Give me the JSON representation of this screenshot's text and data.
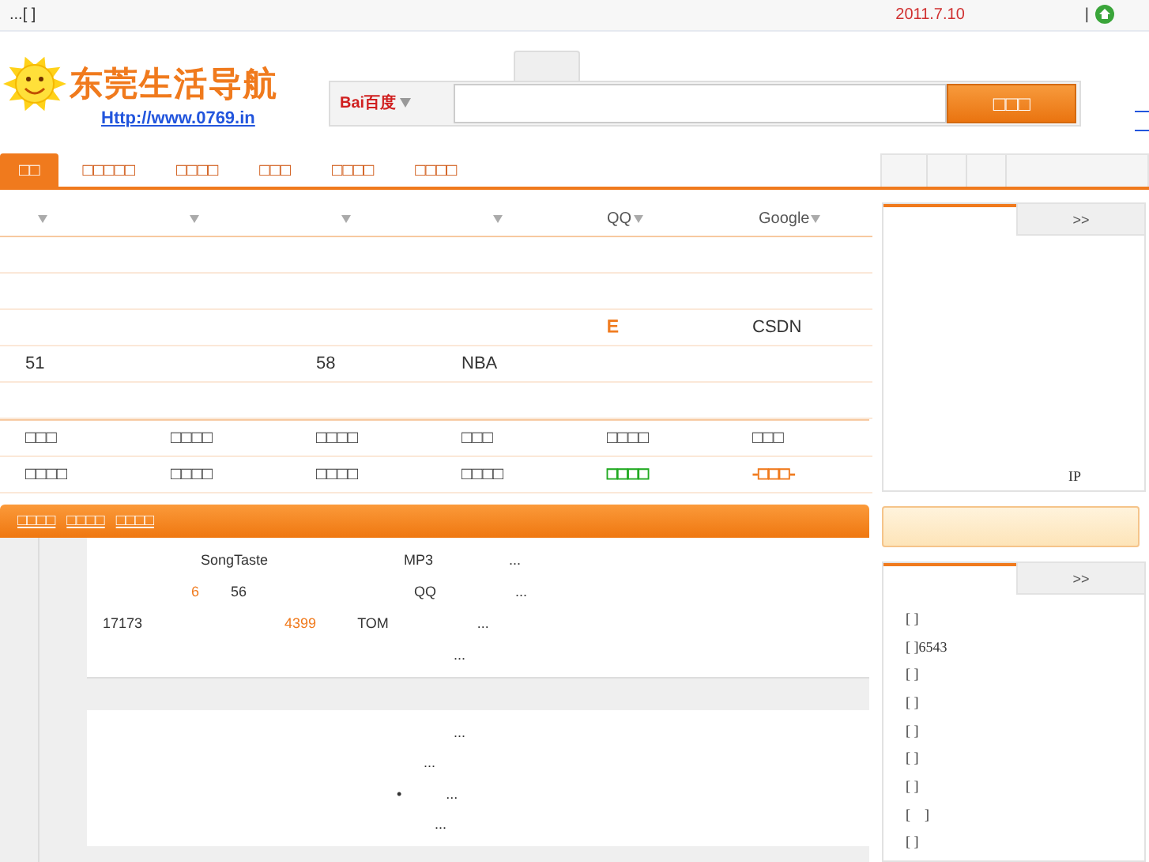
{
  "top_bar": {
    "left_text": "...[ ]",
    "date": "2011.7.10",
    "separator": "|"
  },
  "header": {
    "logo_text": "东莞生活导航",
    "site_link": "Http://www.0769.in",
    "search": {
      "engine": "Bai百度",
      "button": "□□□"
    }
  },
  "nav": {
    "tabs": [
      {
        "label": "□□",
        "selected": true
      },
      {
        "label": "□□□□□",
        "selected": false
      },
      {
        "label": "□□□□",
        "selected": false
      },
      {
        "label": "□□□",
        "selected": false
      },
      {
        "label": "□□□□",
        "selected": false
      },
      {
        "label": "□□□□",
        "selected": false
      }
    ]
  },
  "table": {
    "columns": [
      {
        "sortable": true
      },
      {
        "sortable": true
      },
      {
        "sortable": true
      },
      {
        "sortable": true
      },
      {
        "label": "QQ",
        "sortable": true
      },
      {
        "label": "Google",
        "sortable": true
      }
    ],
    "rows": [
      {},
      {},
      {
        "column_5": {
          "text": "E",
          "color": "#f07a1d"
        },
        "column_6": {
          "text": "CSDN"
        }
      },
      {
        "column_1": {
          "text": "51"
        },
        "column_3": {
          "text": "58"
        },
        "column_4": {
          "text": "NBA"
        }
      },
      {}
    ]
  },
  "quick_links": {
    "rows": [
      {
        "column_1": {
          "text": "□□□"
        },
        "column_2": {
          "text": "□□□□"
        },
        "column_3": {
          "text": "□□□□"
        },
        "column_4": {
          "text": "□□□"
        },
        "column_5": {
          "text": "□□□□"
        },
        "column_6": {
          "text": "□□□"
        }
      },
      {
        "column_1": {
          "text": "□□□□"
        },
        "column_2": {
          "text": "□□□□"
        },
        "column_3": {
          "text": "□□□□"
        },
        "column_4": {
          "text": "□□□□"
        },
        "column_5": {
          "text": "□□□□",
          "color": "#22aa22"
        },
        "column_6": {
          "text": "-□□□-",
          "color": "#f07a1d"
        }
      }
    ]
  },
  "content_panel": {
    "tabs": [
      "□□□□",
      "□□□□",
      "□□□□"
    ],
    "blocks": [
      [
        [
          {
            "text": "SongTaste"
          },
          {
            "text": "MP3"
          },
          {
            "text": "..."
          }
        ],
        [
          {
            "text": "6",
            "color": "#f07a1d"
          },
          {
            "text": "56"
          },
          {
            "text": "QQ"
          },
          {
            "text": "..."
          }
        ],
        [
          {
            "text": "17173"
          },
          {
            "text": "4399",
            "color": "#f07a1d"
          },
          {
            "text": "TOM"
          },
          {
            "text": "..."
          }
        ],
        [
          {
            "text": "..."
          }
        ]
      ],
      [
        [
          {
            "text": "..."
          }
        ],
        [
          {
            "text": "..."
          }
        ],
        [
          {
            "text": "•"
          },
          {
            "text": "..."
          }
        ],
        [
          {
            "text": "..."
          }
        ]
      ]
    ]
  },
  "side_panel_1": {
    "more": ">>",
    "footer": "IP"
  },
  "side_panel_2": {
    "more": ">>",
    "items": [
      "[ ]",
      "[ ]6543",
      "[ ]",
      "[ ]",
      "[ ]",
      "[ ]",
      "[ ]",
      "[    ]",
      "[ ]"
    ]
  }
}
